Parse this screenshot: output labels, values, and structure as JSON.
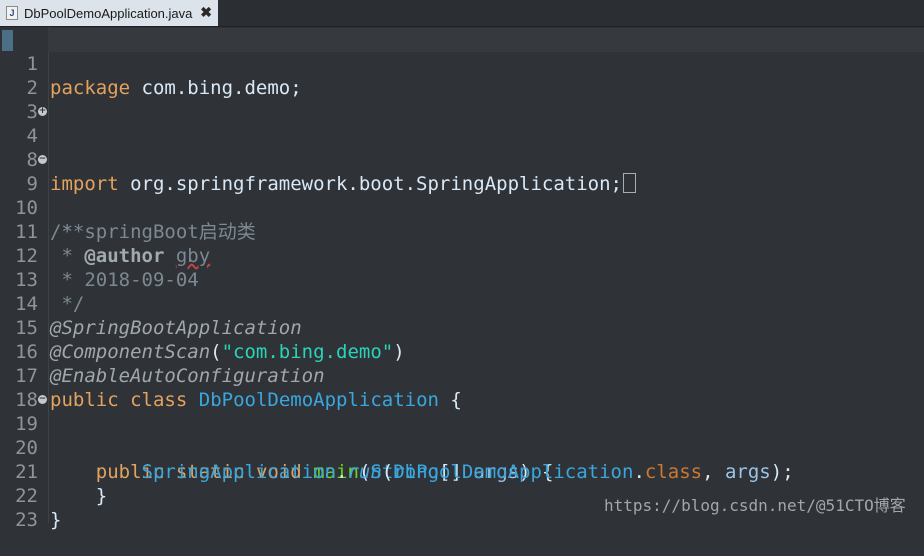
{
  "tab": {
    "icon_text": "J",
    "title": "DbPoolDemoApplication.java",
    "close_glyph": "✖"
  },
  "lines": {
    "l1": "1",
    "l2": "2",
    "l3": "3",
    "l4": "4",
    "l8": "8",
    "l9": "9",
    "l10": "10",
    "l11": "11",
    "l12": "12",
    "l13": "13",
    "l14": "14",
    "l15": "15",
    "l16": "16",
    "l17": "17",
    "l18": "18",
    "l19": "19",
    "l20": "20",
    "l21": "21",
    "l22": "22",
    "l23": "23"
  },
  "code": {
    "package_kw": "package",
    "package_name": " com.bing.demo;",
    "import_kw": "import",
    "import_name": " org.springframework.boot.SpringApplication;",
    "doc_open": "/**",
    "doc_l1": " * springBoot启动类",
    "doc_l2_star": " * ",
    "doc_l2_tag": "@author",
    "doc_l2_name": "gby",
    "doc_l3": " * 2018-09-04",
    "doc_close": " */",
    "ann1": "@SpringBootApplication",
    "ann2": "@ComponentScan",
    "ann2_open": "(",
    "ann2_str": "\"com.bing.demo\"",
    "ann2_close": ")",
    "ann3": "@EnableAutoConfiguration",
    "cls_public": "public",
    "cls_class": "class",
    "cls_name": "DbPoolDemoApplication",
    "cls_brace": " {",
    "m_public": "public",
    "m_static": "static",
    "m_void": "void",
    "m_name": "main",
    "m_p1": "(",
    "m_type": "String",
    "m_arr": "[] ",
    "m_arg": "args",
    "m_p2": ") {",
    "r_cls": "SpringApplication",
    "r_dot": ".",
    "r_run": "run",
    "r_p1": "(",
    "r_arg1": "DbPoolDemoApplication",
    "r_dot2": ".",
    "r_class": "class",
    "r_comma": ", ",
    "r_args": "args",
    "r_end": ");",
    "inner_close": "}",
    "outer_close": "}"
  },
  "watermark": "https://blog.csdn.net/@51CTO博客"
}
